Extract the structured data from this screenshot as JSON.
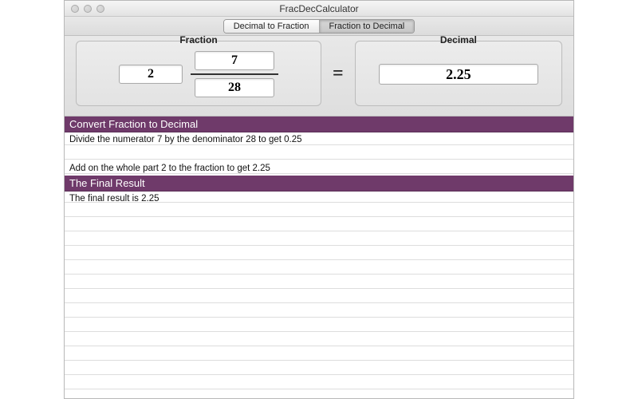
{
  "window": {
    "title": "FracDecCalculator"
  },
  "tabs": {
    "decimal_to_fraction": "Decimal to Fraction",
    "fraction_to_decimal": "Fraction to Decimal"
  },
  "labels": {
    "fraction": "Fraction",
    "decimal": "Decimal",
    "equals": "="
  },
  "inputs": {
    "whole": "2",
    "numerator": "7",
    "denominator": "28",
    "decimal": "2.25"
  },
  "sections": {
    "convert_header": "Convert Fraction to Decimal",
    "step1": "Divide the numerator 7 by the denominator 28 to get 0.25",
    "step2": "Add on the whole part 2 to the fraction to get 2.25",
    "final_header": "The Final Result",
    "final_text": "The final result is 2.25"
  }
}
